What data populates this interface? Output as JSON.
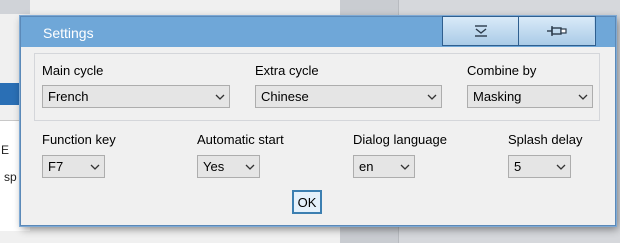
{
  "background": {
    "fragment_1": "E",
    "fragment_2": "sp"
  },
  "window": {
    "title": "Settings"
  },
  "titlebar_buttons": {
    "first_icon": "filter-arrow-icon",
    "second_icon": "pin-icon"
  },
  "fields": {
    "main_cycle": {
      "label": "Main cycle",
      "value": "French"
    },
    "extra_cycle": {
      "label": "Extra cycle",
      "value": "Chinese"
    },
    "combine_by": {
      "label": "Combine by",
      "value": "Masking"
    },
    "function_key": {
      "label": "Function key",
      "value": "F7"
    },
    "automatic_start": {
      "label": "Automatic start",
      "value": "Yes"
    },
    "dialog_language": {
      "label": "Dialog language",
      "value": "en"
    },
    "splash_delay": {
      "label": "Splash delay",
      "value": "5"
    }
  },
  "ok_label": "OK",
  "colors": {
    "titlebar": "#6fa7d8",
    "accent": "#3c7fb1"
  }
}
